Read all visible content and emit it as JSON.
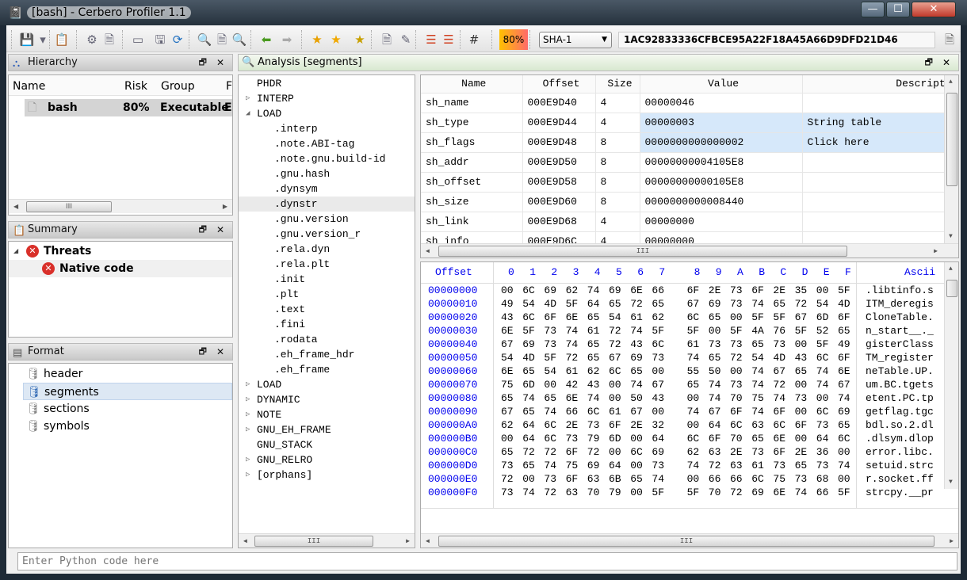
{
  "window": {
    "title": "[bash] - Cerbero Profiler 1.1",
    "minimize": "—",
    "maximize": "☐",
    "close": "✕"
  },
  "toolbar": {
    "icons": [
      "save-icon",
      "dropdown-arrow-icon",
      "clipboard-icon",
      "gear-icon",
      "settings-doc-icon",
      "window-icon",
      "save-disk-icon",
      "refresh-icon",
      "zoom-in-icon",
      "add-doc-icon",
      "find-x-icon",
      "back-arrow-icon",
      "forward-arrow-icon",
      "bookmark-globe-icon",
      "star-icon",
      "add-star-icon",
      "globe-doc-icon",
      "edit-doc-icon",
      "layout-icon",
      "layout-search-icon",
      "hash-icon"
    ],
    "risk": "80%",
    "hash_algo": "SHA-1",
    "hash_value": "1AC92833336CFBCE95A22F18A45A66D9DFD21D46",
    "hash_icon": "copy-doc-icon"
  },
  "hierarchy": {
    "title": "Hierarchy",
    "columns": [
      "Name",
      "Risk",
      "Group",
      "Fo"
    ],
    "rows": [
      {
        "name": "bash",
        "risk": "80%",
        "group": "Executable",
        "format": "El"
      }
    ]
  },
  "summary": {
    "title": "Summary",
    "items": [
      {
        "label": "Threats",
        "level": 0
      },
      {
        "label": "Native code",
        "level": 1
      }
    ]
  },
  "format": {
    "title": "Format",
    "items": [
      "header",
      "segments",
      "sections",
      "symbols"
    ],
    "selected": "segments"
  },
  "analysis": {
    "title": "Analysis [segments]",
    "tree": [
      {
        "label": "PHDR",
        "level": 0,
        "arrow": ""
      },
      {
        "label": "INTERP",
        "level": 0,
        "arrow": "▷"
      },
      {
        "label": "LOAD",
        "level": 0,
        "arrow": "◢"
      },
      {
        "label": ".interp",
        "level": 1,
        "arrow": ""
      },
      {
        "label": ".note.ABI-tag",
        "level": 1,
        "arrow": ""
      },
      {
        "label": ".note.gnu.build-id",
        "level": 1,
        "arrow": ""
      },
      {
        "label": ".gnu.hash",
        "level": 1,
        "arrow": ""
      },
      {
        "label": ".dynsym",
        "level": 1,
        "arrow": ""
      },
      {
        "label": ".dynstr",
        "level": 1,
        "arrow": "",
        "selected": true
      },
      {
        "label": ".gnu.version",
        "level": 1,
        "arrow": ""
      },
      {
        "label": ".gnu.version_r",
        "level": 1,
        "arrow": ""
      },
      {
        "label": ".rela.dyn",
        "level": 1,
        "arrow": ""
      },
      {
        "label": ".rela.plt",
        "level": 1,
        "arrow": ""
      },
      {
        "label": ".init",
        "level": 1,
        "arrow": ""
      },
      {
        "label": ".plt",
        "level": 1,
        "arrow": ""
      },
      {
        "label": ".text",
        "level": 1,
        "arrow": ""
      },
      {
        "label": ".fini",
        "level": 1,
        "arrow": ""
      },
      {
        "label": ".rodata",
        "level": 1,
        "arrow": ""
      },
      {
        "label": ".eh_frame_hdr",
        "level": 1,
        "arrow": ""
      },
      {
        "label": ".eh_frame",
        "level": 1,
        "arrow": ""
      },
      {
        "label": "LOAD",
        "level": 0,
        "arrow": "▷"
      },
      {
        "label": "DYNAMIC",
        "level": 0,
        "arrow": "▷"
      },
      {
        "label": "NOTE",
        "level": 0,
        "arrow": "▷"
      },
      {
        "label": "GNU_EH_FRAME",
        "level": 0,
        "arrow": "▷"
      },
      {
        "label": "GNU_STACK",
        "level": 0,
        "arrow": ""
      },
      {
        "label": "GNU_RELRO",
        "level": 0,
        "arrow": "▷"
      },
      {
        "label": "[orphans]",
        "level": 0,
        "arrow": "▷"
      }
    ],
    "table": {
      "columns": [
        "Name",
        "Offset",
        "Size",
        "Value",
        "Descripti"
      ],
      "rows": [
        [
          "sh_name",
          "000E9D40",
          "4",
          "00000046",
          ""
        ],
        [
          "sh_type",
          "000E9D44",
          "4",
          "00000003",
          "String table"
        ],
        [
          "sh_flags",
          "000E9D48",
          "8",
          "0000000000000002",
          "Click here"
        ],
        [
          "sh_addr",
          "000E9D50",
          "8",
          "00000000004105E8",
          ""
        ],
        [
          "sh_offset",
          "000E9D58",
          "8",
          "00000000000105E8",
          ""
        ],
        [
          "sh_size",
          "000E9D60",
          "8",
          "0000000000008440",
          ""
        ],
        [
          "sh_link",
          "000E9D68",
          "4",
          "00000000",
          ""
        ],
        [
          "sh_info",
          "000E9D6C",
          "4",
          "00000000",
          ""
        ]
      ],
      "highlighted_rows": [
        1,
        2
      ]
    },
    "hex": {
      "offset_label": "Offset",
      "columns": [
        "0",
        "1",
        "2",
        "3",
        "4",
        "5",
        "6",
        "7",
        "8",
        "9",
        "A",
        "B",
        "C",
        "D",
        "E",
        "F"
      ],
      "ascii_label": "Ascii",
      "rows": [
        {
          "offset": "00000000",
          "bytes": "00 6C 69 62 74 69 6E 66 6F 2E 73 6F 2E 35 00 5F",
          "ascii": ".libtinfo.s"
        },
        {
          "offset": "00000010",
          "bytes": "49 54 4D 5F 64 65 72 65 67 69 73 74 65 72 54 4D",
          "ascii": "ITM_deregis"
        },
        {
          "offset": "00000020",
          "bytes": "43 6C 6F 6E 65 54 61 62 6C 65 00 5F 5F 67 6D 6F",
          "ascii": "CloneTable."
        },
        {
          "offset": "00000030",
          "bytes": "6E 5F 73 74 61 72 74 5F 5F 00 5F 4A 76 5F 52 65",
          "ascii": "n_start__._"
        },
        {
          "offset": "00000040",
          "bytes": "67 69 73 74 65 72 43 6C 61 73 73 65 73 00 5F 49",
          "ascii": "gisterClass"
        },
        {
          "offset": "00000050",
          "bytes": "54 4D 5F 72 65 67 69 73 74 65 72 54 4D 43 6C 6F",
          "ascii": "TM_register"
        },
        {
          "offset": "00000060",
          "bytes": "6E 65 54 61 62 6C 65 00 55 50 00 74 67 65 74 6E",
          "ascii": "neTable.UP."
        },
        {
          "offset": "00000070",
          "bytes": "75 6D 00 42 43 00 74 67 65 74 73 74 72 00 74 67",
          "ascii": "um.BC.tgets"
        },
        {
          "offset": "00000080",
          "bytes": "65 74 65 6E 74 00 50 43 00 74 70 75 74 73 00 74",
          "ascii": "etent.PC.tp"
        },
        {
          "offset": "00000090",
          "bytes": "67 65 74 66 6C 61 67 00 74 67 6F 74 6F 00 6C 69",
          "ascii": "getflag.tgc"
        },
        {
          "offset": "000000A0",
          "bytes": "62 64 6C 2E 73 6F 2E 32 00 64 6C 63 6C 6F 73 65",
          "ascii": "bdl.so.2.dl"
        },
        {
          "offset": "000000B0",
          "bytes": "00 64 6C 73 79 6D 00 64 6C 6F 70 65 6E 00 64 6C",
          "ascii": ".dlsym.dlop"
        },
        {
          "offset": "000000C0",
          "bytes": "65 72 72 6F 72 00 6C 69 62 63 2E 73 6F 2E 36 00",
          "ascii": "error.libc."
        },
        {
          "offset": "000000D0",
          "bytes": "73 65 74 75 69 64 00 73 74 72 63 61 73 65 73 74",
          "ascii": "setuid.strc"
        },
        {
          "offset": "000000E0",
          "bytes": "72 00 73 6F 63 6B 65 74 00 66 66 6C 75 73 68 00",
          "ascii": "r.socket.ff"
        },
        {
          "offset": "000000F0",
          "bytes": "73 74 72 63 70 79 00 5F 5F 70 72 69 6E 74 66 5F",
          "ascii": "strcpy.__pr"
        }
      ]
    }
  },
  "python": {
    "placeholder": "Enter Python code here"
  },
  "colors": {
    "hex_offset": "#0000ee",
    "selection": "#d6e8fa",
    "risk_gradient_start": "#ffc000",
    "risk_gradient_end": "#ff6a6a",
    "threat_icon": "#d9302a"
  }
}
